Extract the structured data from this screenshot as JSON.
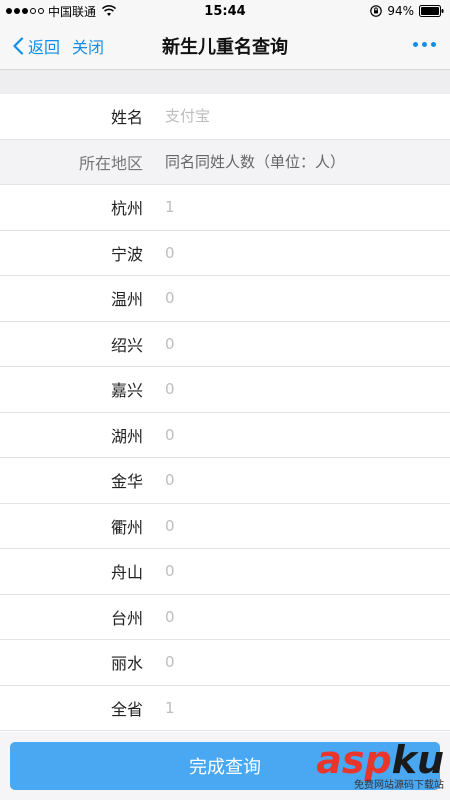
{
  "status_bar": {
    "carrier": "中国联通",
    "time": "15:44",
    "battery": "94%"
  },
  "nav": {
    "back_label": "返回",
    "close_label": "关闭",
    "title": "新生儿重名查询"
  },
  "form": {
    "name_label": "姓名",
    "name_placeholder": "支付宝",
    "header_label": "所在地区",
    "header_value": "同名同姓人数（单位：人）",
    "regions": [
      {
        "name": "杭州",
        "count": "1"
      },
      {
        "name": "宁波",
        "count": "0"
      },
      {
        "name": "温州",
        "count": "0"
      },
      {
        "name": "绍兴",
        "count": "0"
      },
      {
        "name": "嘉兴",
        "count": "0"
      },
      {
        "name": "湖州",
        "count": "0"
      },
      {
        "name": "金华",
        "count": "0"
      },
      {
        "name": "衢州",
        "count": "0"
      },
      {
        "name": "舟山",
        "count": "0"
      },
      {
        "name": "台州",
        "count": "0"
      },
      {
        "name": "丽水",
        "count": "0"
      },
      {
        "name": "全省",
        "count": "1"
      }
    ]
  },
  "bottom": {
    "done_label": "完成查询"
  },
  "watermark": {
    "logo_part1": "asp",
    "logo_part2": "ku",
    "sub": "免费网站源码下载站"
  },
  "colors": {
    "accent": "#108ee9",
    "button": "#4aa7f2"
  }
}
